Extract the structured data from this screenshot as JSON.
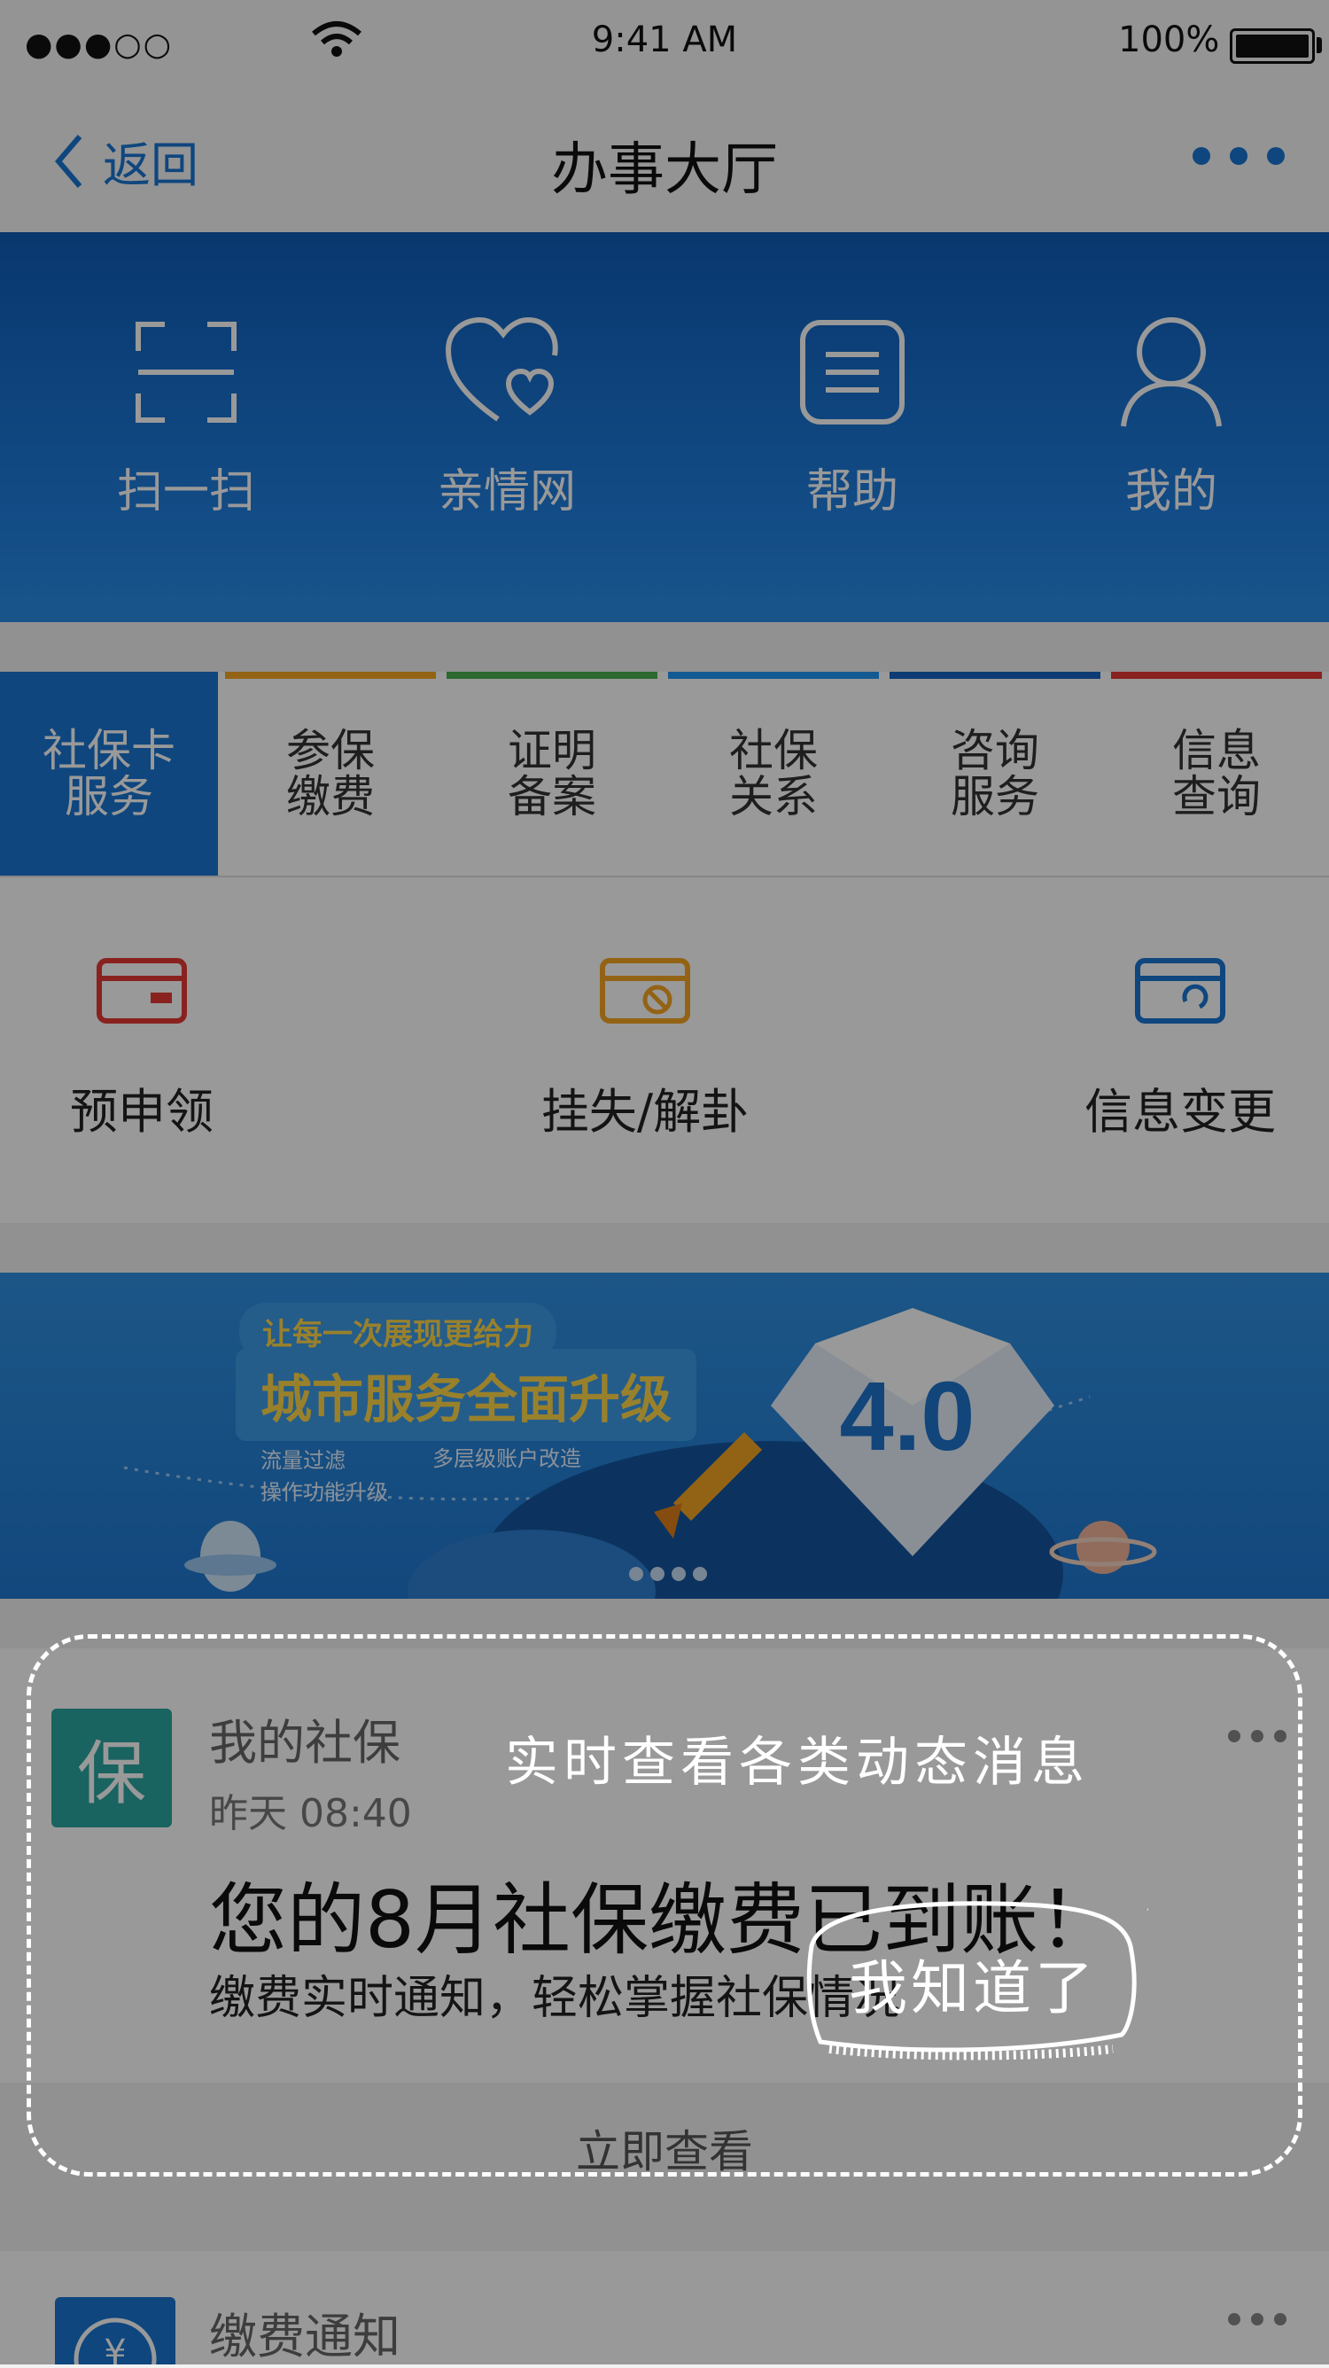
{
  "status_bar": {
    "time": "9:41 AM",
    "battery": "100%",
    "signal": "●●●○○"
  },
  "nav": {
    "back_label": "返回",
    "title": "办事大厅"
  },
  "quick_actions": [
    {
      "label": "扫一扫",
      "icon": "scan-icon"
    },
    {
      "label": "亲情网",
      "icon": "hearts-icon"
    },
    {
      "label": "帮助",
      "icon": "help-document-icon"
    },
    {
      "label": "我的",
      "icon": "user-icon"
    }
  ],
  "tabs": [
    {
      "line1": "社保卡",
      "line2": "服务",
      "color": "#1976d2",
      "active": true
    },
    {
      "line1": "参保",
      "line2": "缴费",
      "color": "#f5a623"
    },
    {
      "line1": "证明",
      "line2": "备案",
      "color": "#4caf50"
    },
    {
      "line1": "社保",
      "line2": "关系",
      "color": "#2196f3"
    },
    {
      "line1": "咨询",
      "line2": "服务",
      "color": "#1565c0"
    },
    {
      "line1": "信息",
      "line2": "查询",
      "color": "#e53935"
    }
  ],
  "services": [
    {
      "label": "预申领",
      "icon": "card-icon",
      "color": "#e53935"
    },
    {
      "label": "挂失/解卦",
      "icon": "card-block-icon",
      "color": "#f5a623"
    },
    {
      "label": "信息变更",
      "icon": "card-refresh-icon",
      "color": "#1976d2"
    }
  ],
  "banner": {
    "pill": "让每一次展现更给力",
    "headline": "城市服务全面升级",
    "bullets": [
      "流量过滤",
      "多层级账户改造",
      "操作功能升级"
    ],
    "badge": "4.0"
  },
  "message": {
    "avatar": "保",
    "sender": "我的社保",
    "time": "昨天 08:40",
    "title": "您的8月社保缴费已到账！",
    "desc": "缴费实时通知，轻松掌握社保情况",
    "action": "立即查看"
  },
  "message2": {
    "title": "缴费通知"
  },
  "guide": {
    "tip": "实时查看各类动态消息",
    "confirm": "我知道了"
  },
  "colors": {
    "primary": "#1976d2",
    "avatar_teal": "#2aa5a0"
  }
}
